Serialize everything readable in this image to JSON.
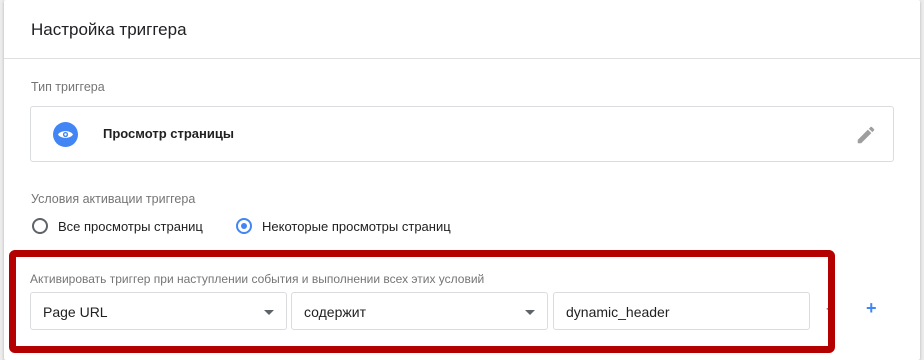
{
  "card": {
    "title": "Настройка триггера"
  },
  "trigger_type": {
    "section_label": "Тип триггера",
    "name": "Просмотр страницы",
    "icon": "eye-icon",
    "edit_icon": "pencil-icon"
  },
  "activation": {
    "section_label": "Условия активации триггера",
    "options": [
      {
        "label": "Все просмотры страниц",
        "checked": false
      },
      {
        "label": "Некоторые просмотры страниц",
        "checked": true
      }
    ]
  },
  "condition": {
    "label": "Активировать триггер при наступлении события и выполнении всех этих условий",
    "variable": "Page URL",
    "operator": "содержит",
    "value": "dynamic_header",
    "remove_label": "-",
    "add_label": "+"
  },
  "colors": {
    "accent": "#4285f4",
    "highlight_border": "#b40000"
  }
}
